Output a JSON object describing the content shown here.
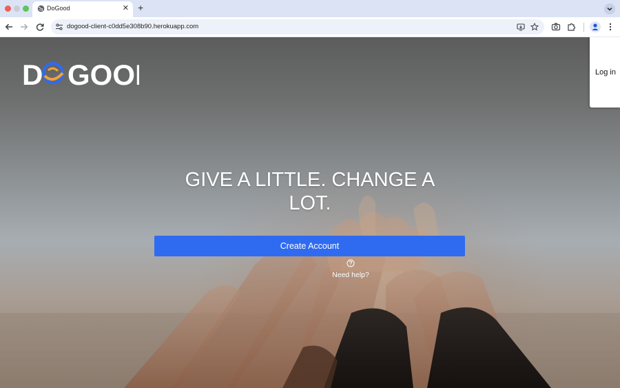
{
  "browser": {
    "tab": {
      "title": "DoGood",
      "favicon": "globe-icon",
      "close_icon": "close-icon"
    },
    "new_tab_icon": "plus-icon",
    "tab_menu_icon": "chevron-down-icon",
    "toolbar": {
      "back_icon": "arrow-left-icon",
      "forward_icon": "arrow-right-icon",
      "reload_icon": "reload-icon",
      "site_info_icon": "tune-icon",
      "url": "dogood-client-c0dd5e308b90.herokuapp.com",
      "omnibox_icons": [
        "install-app-icon",
        "star-icon"
      ],
      "right_icons": [
        "camera-icon",
        "extensions-icon",
        "profile-icon",
        "more-vert-icon"
      ]
    }
  },
  "page": {
    "logo": {
      "text_left": "D",
      "text_right": "GOOD",
      "brand_blue": "#2f6bf0",
      "brand_orange": "#f0a23a"
    },
    "nav": {
      "login_label": "Log in"
    },
    "hero": {
      "title": "GIVE A LITTLE. CHANGE A LOT.",
      "cta_label": "Create Account",
      "help_icon": "question-circle-icon",
      "help_label": "Need help?"
    },
    "colors": {
      "cta": "#2f6bf0",
      "hero_text": "#ffffff"
    }
  }
}
